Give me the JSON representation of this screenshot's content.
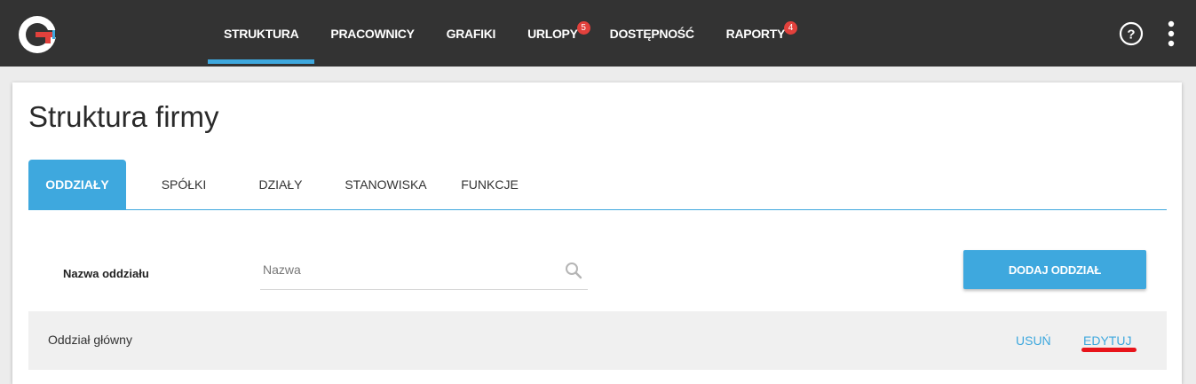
{
  "nav": {
    "items": [
      {
        "label": "STRUKTURA"
      },
      {
        "label": "PRACOWNICY"
      },
      {
        "label": "GRAFIKI"
      },
      {
        "label": "URLOPY",
        "badge": "5"
      },
      {
        "label": "DOSTĘPNOŚĆ"
      },
      {
        "label": "RAPORTY",
        "badge": "4"
      }
    ],
    "active": "STRUKTURA",
    "icons": [
      "help-icon",
      "more-icon"
    ]
  },
  "page": {
    "title": "Struktura firmy"
  },
  "tabs": [
    {
      "label": "ODDZIAŁY"
    },
    {
      "label": "SPÓŁKI"
    },
    {
      "label": "DZIAŁY"
    },
    {
      "label": "STANOWISKA"
    },
    {
      "label": "FUNKCJE"
    }
  ],
  "active_tab": "ODDZIAŁY",
  "filter": {
    "label": "Nazwa oddziału",
    "placeholder": "Nazwa",
    "value": ""
  },
  "actions": {
    "add_label": "DODAJ ODDZIAŁ"
  },
  "rows": [
    {
      "name": "Oddział główny",
      "delete_label": "USUŃ",
      "edit_label": "EDYTUJ"
    }
  ],
  "colors": {
    "accent": "#3ea8de",
    "topbar": "#333333",
    "badge": "#e2413c",
    "highlight": "#e8141b"
  }
}
